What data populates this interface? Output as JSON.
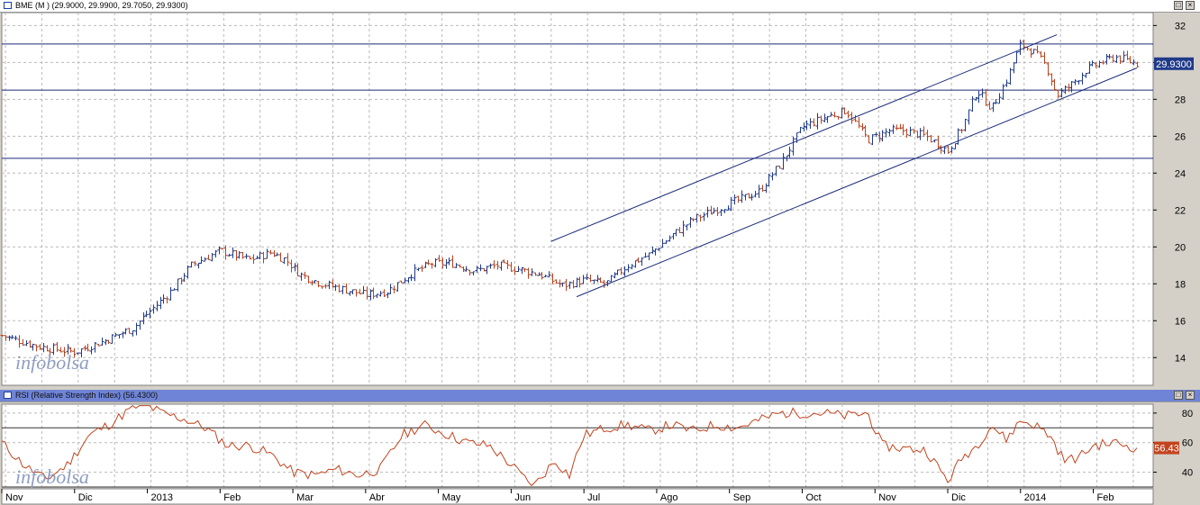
{
  "price_panel": {
    "title": "BME (M ) (29.9000, 29.9900, 29.7050, 29.9300)",
    "last_value_label": "29.9300",
    "watermark": "infobolsa",
    "colors": {
      "up": "#1f3a8a",
      "down": "#b8421e",
      "grid": "#b9b9b9",
      "line": "#1a2a7a"
    }
  },
  "rsi_panel": {
    "title": "RSI (Relative Strength Index) (56.4300)",
    "last_value_label": "56.43",
    "watermark": "infobolsa",
    "colors": {
      "line": "#c2441e",
      "band": "#333333",
      "label_bg": "#c2441e"
    }
  },
  "window_buttons": {
    "minimize": "−",
    "restore": "□",
    "close": "×"
  },
  "chart_data": [
    {
      "type": "line",
      "title": "BME (M ) (29.9000, 29.9900, 29.7050, 29.9300)",
      "chart_style": "ohlc-bars",
      "xlabel": "",
      "ylabel": "",
      "ylim": [
        12.5,
        32.7
      ],
      "yticks": [
        14,
        16,
        18,
        20,
        22,
        24,
        26,
        28,
        30,
        32
      ],
      "x_axis_labels": [
        "Nov",
        "Dic",
        "2013",
        "Feb",
        "Mar",
        "Abr",
        "May",
        "Jun",
        "Jul",
        "Ago",
        "Sep",
        "Oct",
        "Nov",
        "Dic",
        "2014",
        "Feb"
      ],
      "x_axis_label_positions": [
        0.5,
        1.5,
        2.5,
        3.5,
        4.5,
        5.5,
        6.5,
        7.5,
        8.5,
        9.5,
        10.5,
        11.5,
        12.5,
        13.5,
        14.5,
        15.5
      ],
      "month_index_range": [
        0,
        15.6
      ],
      "series": [
        {
          "values_x_month_index": [
            0,
            0.5,
            1.0,
            1.4,
            1.8,
            2.0,
            2.3,
            2.6,
            3.0,
            3.4,
            3.7,
            3.9,
            4.1,
            4.4,
            4.7,
            5.0,
            5.3,
            5.6,
            5.9,
            6.2,
            6.5,
            6.8,
            7.1,
            7.4,
            7.7,
            8.0,
            8.3,
            8.6,
            8.9,
            9.2,
            9.5,
            9.8,
            10.1,
            10.4,
            10.7,
            11.0,
            11.3,
            11.6,
            11.9,
            12.2,
            12.4,
            12.7,
            13.0,
            13.2,
            13.4,
            13.6,
            13.8,
            14.0,
            14.2,
            14.35,
            14.5,
            14.7,
            14.9,
            15.1,
            15.3,
            15.6
          ],
          "values_y": [
            15.2,
            14.6,
            14.3,
            14.9,
            15.6,
            16.4,
            17.5,
            19.0,
            19.8,
            19.3,
            19.7,
            19.3,
            18.5,
            18.0,
            17.7,
            17.4,
            17.6,
            18.5,
            19.1,
            19.1,
            18.7,
            19.0,
            18.8,
            18.5,
            17.9,
            18.2,
            18.0,
            19.0,
            19.6,
            20.6,
            21.5,
            22.0,
            22.5,
            23.0,
            24.5,
            26.5,
            27.0,
            27.4,
            25.8,
            26.3,
            26.3,
            26.0,
            25.2,
            26.5,
            28.5,
            27.5,
            29.0,
            31.0,
            30.5,
            29.8,
            28.2,
            28.8,
            29.6,
            30.0,
            30.3,
            29.93
          ]
        }
      ],
      "channel_upper_line": {
        "x_month_index": [
          7.55,
          14.5
        ],
        "y": [
          20.3,
          31.5
        ]
      },
      "channel_lower_line": {
        "x_month_index": [
          7.9,
          15.6
        ],
        "y": [
          17.3,
          29.7
        ]
      },
      "horizontal_lines_y": [
        31.0,
        28.5,
        24.8
      ]
    },
    {
      "type": "line",
      "title": "RSI (Relative Strength Index) (56.4300)",
      "xlabel": "",
      "ylabel": "",
      "ylim": [
        30,
        86
      ],
      "yticks": [
        40,
        60,
        80
      ],
      "band_lines_y": [
        70,
        30
      ],
      "month_index_range": [
        0,
        15.6
      ],
      "series": [
        {
          "values_x_month_index": [
            0,
            0.3,
            0.6,
            0.9,
            1.2,
            1.5,
            1.8,
            2.0,
            2.2,
            2.5,
            2.8,
            3.1,
            3.4,
            3.7,
            4.0,
            4.3,
            4.6,
            4.9,
            5.2,
            5.5,
            5.8,
            6.1,
            6.4,
            6.7,
            7.0,
            7.3,
            7.6,
            7.8,
            8.0,
            8.3,
            8.6,
            8.9,
            9.2,
            9.5,
            9.8,
            10.1,
            10.4,
            10.7,
            11.0,
            11.3,
            11.6,
            11.9,
            12.1,
            12.4,
            12.7,
            13.0,
            13.2,
            13.4,
            13.6,
            13.8,
            14.0,
            14.2,
            14.4,
            14.6,
            14.8,
            15.0,
            15.3,
            15.6
          ],
          "values_y": [
            60,
            45,
            35,
            45,
            65,
            73,
            84,
            85,
            80,
            76,
            70,
            58,
            58,
            52,
            40,
            38,
            42,
            38,
            42,
            65,
            72,
            66,
            60,
            58,
            45,
            30,
            48,
            38,
            65,
            70,
            72,
            68,
            72,
            68,
            72,
            70,
            75,
            80,
            80,
            80,
            78,
            80,
            58,
            56,
            55,
            34,
            50,
            58,
            72,
            62,
            75,
            72,
            65,
            48,
            50,
            58,
            60,
            56.43
          ]
        }
      ]
    }
  ]
}
